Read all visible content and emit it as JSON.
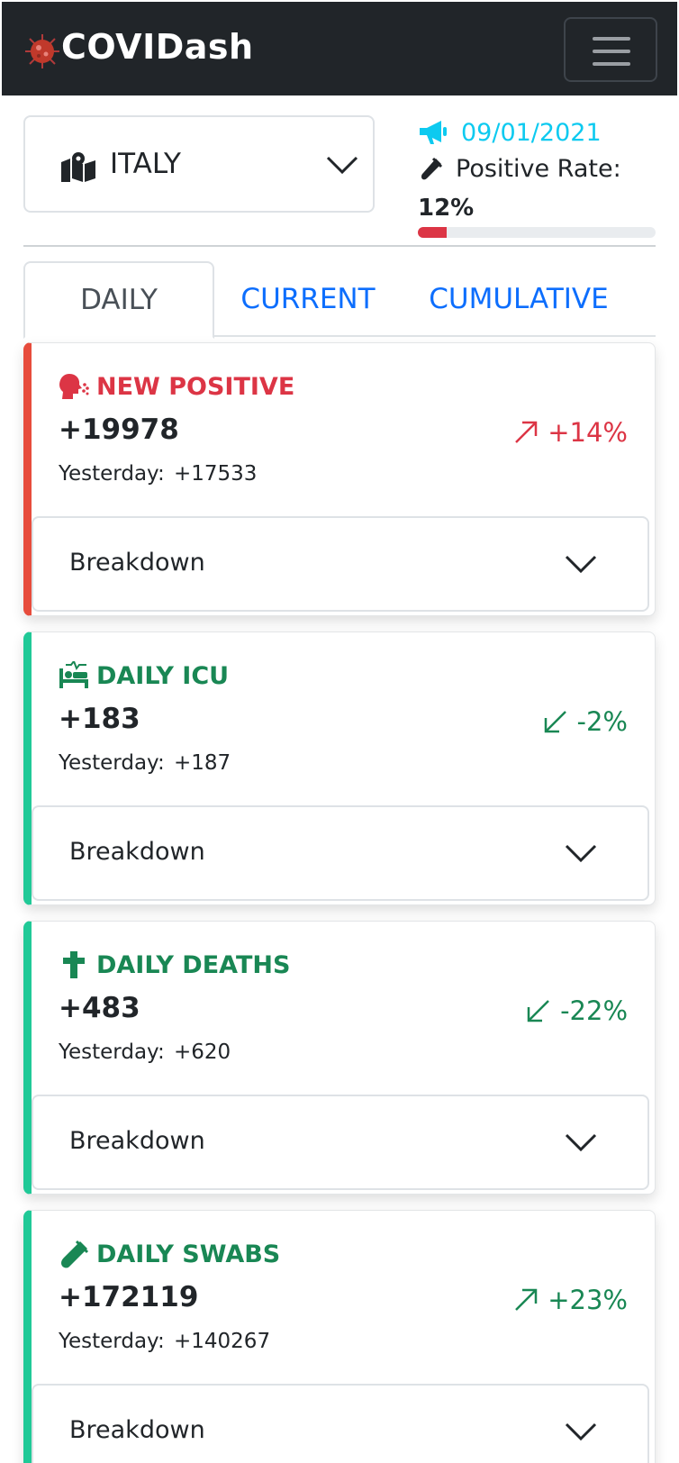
{
  "app": {
    "brand": "COVIDash"
  },
  "selector": {
    "country": "ITALY"
  },
  "info": {
    "date": "09/01/2021",
    "positive_rate_label": "Positive Rate:",
    "positive_rate_value": "12%",
    "positive_rate_fraction": 0.12
  },
  "tabs": [
    {
      "label": "DAILY",
      "active": true
    },
    {
      "label": "CURRENT",
      "active": false
    },
    {
      "label": "CUMULATIVE",
      "active": false
    }
  ],
  "cards": [
    {
      "title": "NEW POSITIVE",
      "icon": "cough-icon",
      "value": "+19978",
      "yesterday_label": "Yesterday:",
      "yesterday_value": "+17533",
      "trend": "+14%",
      "trend_direction": "up",
      "color": "#dc3545",
      "accent": "#e74c3c",
      "breakdown_label": "Breakdown"
    },
    {
      "title": "DAILY ICU",
      "icon": "hospital-bed-icon",
      "value": "+183",
      "yesterday_label": "Yesterday:",
      "yesterday_value": "+187",
      "trend": "-2%",
      "trend_direction": "down",
      "color": "#198754",
      "accent": "#20c997",
      "breakdown_label": "Breakdown"
    },
    {
      "title": "DAILY DEATHS",
      "icon": "cross-icon",
      "value": "+483",
      "yesterday_label": "Yesterday:",
      "yesterday_value": "+620",
      "trend": "-22%",
      "trend_direction": "down",
      "color": "#198754",
      "accent": "#20c997",
      "breakdown_label": "Breakdown"
    },
    {
      "title": "DAILY SWABS",
      "icon": "test-tube-icon",
      "value": "+172119",
      "yesterday_label": "Yesterday:",
      "yesterday_value": "+140267",
      "trend": "+23%",
      "trend_direction": "up",
      "color": "#198754",
      "accent": "#20c997",
      "breakdown_label": "Breakdown"
    }
  ],
  "colors": {
    "navbar": "#212529",
    "info": "#0dcaf0",
    "link": "#0d6efd",
    "danger": "#dc3545",
    "success": "#198754"
  }
}
